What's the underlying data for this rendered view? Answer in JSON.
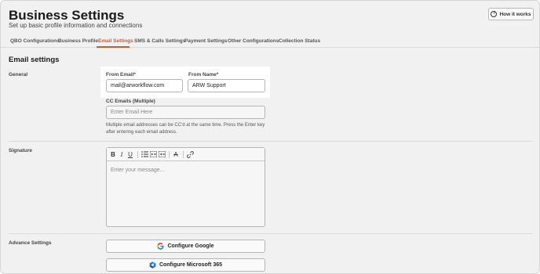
{
  "header": {
    "title": "Business Settings",
    "subtitle": "Set up basic profile information and connections",
    "how_it_works_label": "How it works"
  },
  "tabs": [
    {
      "label": "QBO Configurations"
    },
    {
      "label": "Business Profile"
    },
    {
      "label": "Email Settings",
      "active": true
    },
    {
      "label": "SMS & Calls Settings"
    },
    {
      "label": "Payment Settings"
    },
    {
      "label": "Other Configurations"
    },
    {
      "label": "Collection Status"
    }
  ],
  "email_settings": {
    "section_title": "Email settings",
    "general_label": "General",
    "from_email_label": "From Email*",
    "from_email_value": "mail@arworkflow.com",
    "from_name_label": "From Name*",
    "from_name_value": "ARW Support",
    "cc_label": "CC Emails (Multiple)",
    "cc_placeholder": "Enter Email Here",
    "cc_help": "Multiple email addresses can be CC'd at the same time. Press the Enter key after entering each email address.",
    "signature_label": "Signature",
    "signature_placeholder": "Enter your message...",
    "advance_label": "Advance Settings",
    "configure_google_label": "Configure Google",
    "configure_microsoft_label": "Configure Microsoft 365"
  },
  "editor_toolbar": [
    "bold-icon",
    "italic-icon",
    "underline-icon",
    "bulleted-list-icon",
    "indent-icon",
    "outdent-icon",
    "clear-format-icon",
    "link-icon"
  ],
  "colors": {
    "accent": "#d8552a",
    "background": "#f1f1f1",
    "highlight": "#ffffff"
  }
}
